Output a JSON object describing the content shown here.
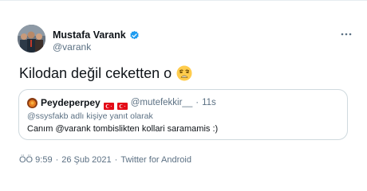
{
  "author": {
    "name": "Mustafa Varank",
    "handle": "@varank",
    "verified": true,
    "avatar_icon": "group-photo-avatar"
  },
  "tweet": {
    "text": "Kilodan değil ceketten o",
    "emoji": "weary-face-emoji"
  },
  "quoted": {
    "name": "Peydeperpey",
    "flags": [
      "turkey-flag",
      "turkey-flag"
    ],
    "handle": "@mutefekkir__",
    "separator": "·",
    "time": "11s",
    "reply_to": "@ssysfakb adlı kişiye yanıt olarak",
    "text": "Canım @varank tombislikten kollari saramamis :)"
  },
  "meta": {
    "time": "ÖÖ 9:59",
    "sep1": "·",
    "date": "26 Şub 2021",
    "sep2": "·",
    "source": "Twitter for Android"
  },
  "colors": {
    "verified": "#1d9bf0",
    "muted": "#5b7083",
    "border": "#cfd9de",
    "flag_red": "#e30a17"
  }
}
